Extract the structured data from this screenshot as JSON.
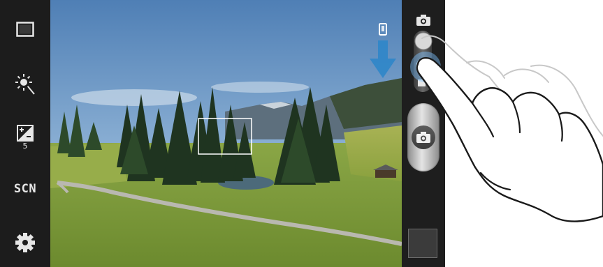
{
  "left_toolbar": {
    "items": [
      {
        "name": "aspect-ratio-icon"
      },
      {
        "name": "brightness-icon"
      },
      {
        "name": "exposure-icon",
        "value": "5"
      },
      {
        "name": "scene-mode",
        "label": "SCN"
      },
      {
        "name": "settings-gear-icon"
      }
    ]
  },
  "viewfinder": {
    "focus_frame": true,
    "swipe_hint": {
      "icon": "phone-icon",
      "arrow": "down-arrow-icon"
    }
  },
  "right_toolbar": {
    "mode_switch": {
      "top_icon": "camera-icon",
      "bottom_icon": "video-icon"
    },
    "shutter": {
      "icon": "camera-icon"
    },
    "thumbnail": {
      "icon": "gallery-thumbnail"
    }
  },
  "colors": {
    "toolbar_bg": "#1c1c1c",
    "hint_arrow": "#2f86c9",
    "sky": "#5e8fc0",
    "grass": "#7d9a3a"
  }
}
